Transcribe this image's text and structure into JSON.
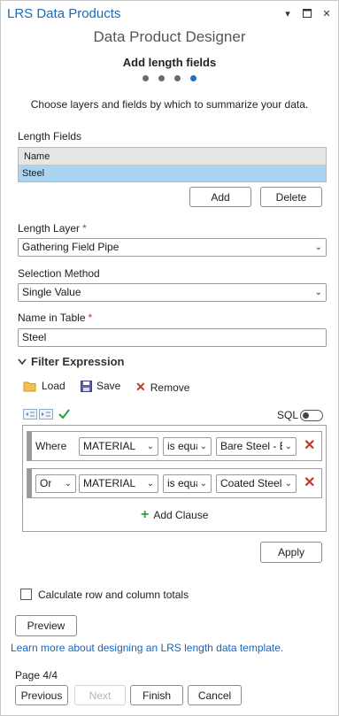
{
  "pane": {
    "title": "LRS Data Products"
  },
  "header": {
    "designer_title": "Data Product Designer",
    "step_title": "Add length fields",
    "steps_total": 4,
    "current_step": 4,
    "instruction": "Choose layers and fields by which to summarize your data."
  },
  "length_fields": {
    "label": "Length Fields",
    "column_header": "Name",
    "rows": [
      "Steel"
    ],
    "add_label": "Add",
    "delete_label": "Delete"
  },
  "length_layer": {
    "label": "Length Layer",
    "value": "Gathering Field Pipe"
  },
  "selection_method": {
    "label": "Selection Method",
    "value": "Single Value"
  },
  "name_in_table": {
    "label": "Name in Table",
    "value": "Steel"
  },
  "filter": {
    "label": "Filter Expression",
    "load_label": "Load",
    "save_label": "Save",
    "remove_label": "Remove",
    "sql_label": "SQL",
    "clauses": [
      {
        "connector": "Where",
        "field": "MATERIAL",
        "operator": "is equal to",
        "value": "Bare Steel - Black"
      },
      {
        "connector": "Or",
        "field": "MATERIAL",
        "operator": "is equal to",
        "value": "Coated Steel"
      }
    ],
    "add_clause_label": "Add Clause",
    "apply_label": "Apply"
  },
  "totals": {
    "label": "Calculate row and column totals",
    "checked": false
  },
  "preview_label": "Preview",
  "learn_more": "Learn more about designing an LRS length data template.",
  "footer": {
    "page_label": "Page 4/4",
    "previous_label": "Previous",
    "next_label": "Next",
    "finish_label": "Finish",
    "cancel_label": "Cancel"
  },
  "colors": {
    "accent": "#1b74c5",
    "required": "#c0392b",
    "selected_row": "#a9d4f2"
  }
}
